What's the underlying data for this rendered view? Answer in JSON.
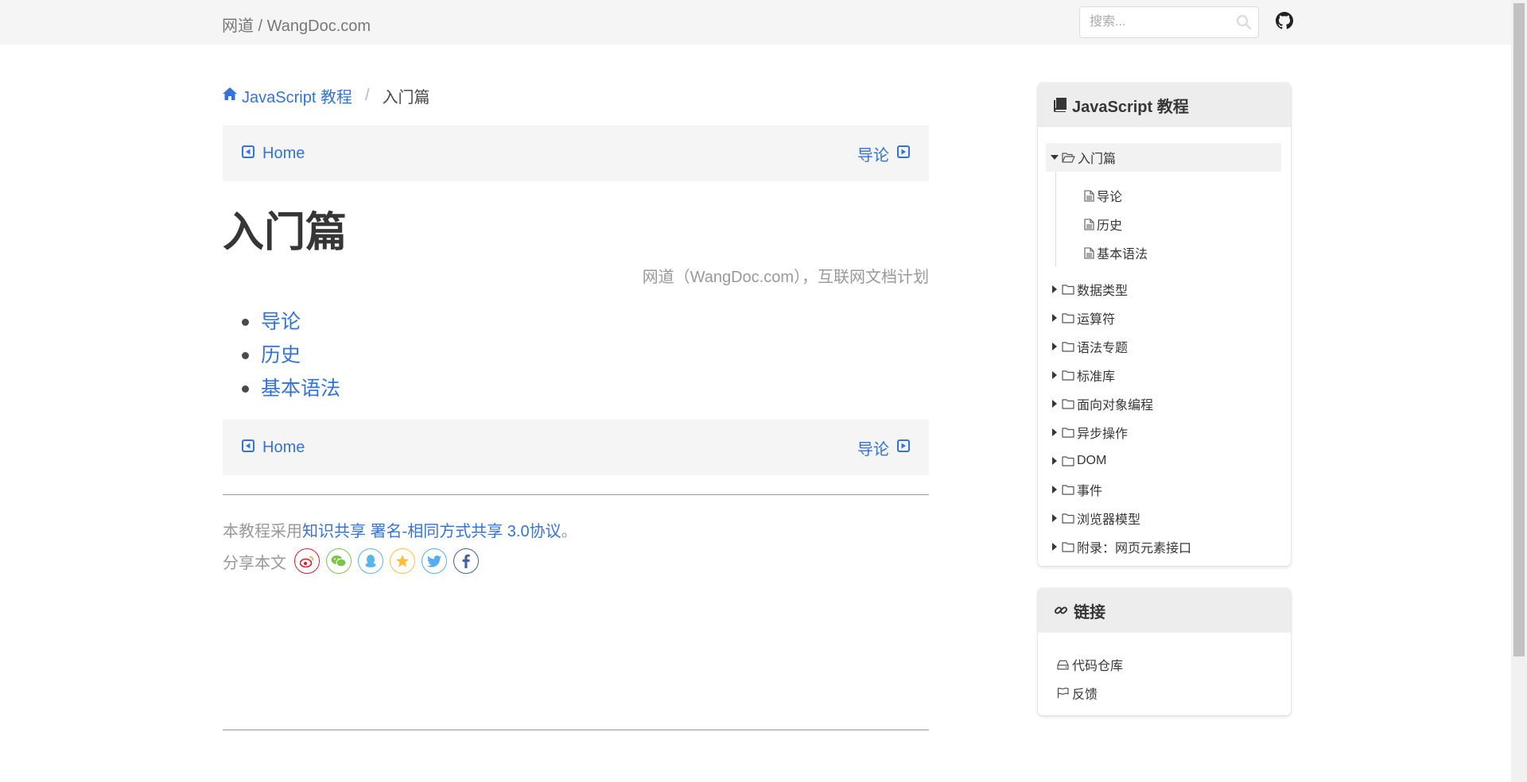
{
  "header": {
    "brand": "网道 / WangDoc.com",
    "search_placeholder": "搜索..."
  },
  "breadcrumb": {
    "root": "JavaScript 教程",
    "current": "入门篇"
  },
  "pager": {
    "prev": "Home",
    "next": "导论"
  },
  "page": {
    "title": "入门篇",
    "subtitle": "网道（WangDoc.com），互联网文档计划",
    "articles": [
      "导论",
      "历史",
      "基本语法"
    ]
  },
  "footer": {
    "license_prefix": "本教程采用",
    "license_link": "知识共享 署名-相同方式共享 3.0协议",
    "license_suffix": "。",
    "share_label": "分享本文"
  },
  "share_buttons": [
    {
      "name": "weibo",
      "color": "#e6162d"
    },
    {
      "name": "wechat",
      "color": "#7bc549"
    },
    {
      "name": "qq",
      "color": "#56b6e7"
    },
    {
      "name": "qzone",
      "color": "#fdbe3d"
    },
    {
      "name": "twitter",
      "color": "#55acee"
    },
    {
      "name": "facebook",
      "color": "#44619d"
    }
  ],
  "sidebar": {
    "toc_title": "JavaScript 教程",
    "active_section": "入门篇",
    "active_children": [
      "导论",
      "历史",
      "基本语法"
    ],
    "sections": [
      "数据类型",
      "运算符",
      "语法专题",
      "标准库",
      "面向对象编程",
      "异步操作",
      "DOM",
      "事件",
      "浏览器模型",
      "附录：网页元素接口"
    ],
    "links_title": "链接",
    "links": [
      "代码仓库",
      "反馈"
    ]
  },
  "colors": {
    "link": "#3273dc",
    "muted": "#999999",
    "panel": "#f5f5f5"
  }
}
